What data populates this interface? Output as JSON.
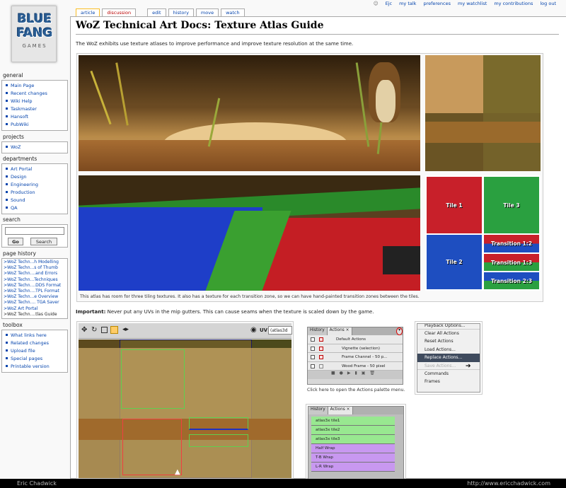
{
  "logo": {
    "line1": "BLUE",
    "line2": "FANG",
    "line3": "GAMES"
  },
  "personal": [
    "Ejc",
    "my talk",
    "preferences",
    "my watchlist",
    "my contributions",
    "log out"
  ],
  "tabs": {
    "article": "article",
    "discussion": "discussion",
    "edit": "edit",
    "history": "history",
    "move": "move",
    "watch": "watch"
  },
  "sidebar": {
    "general": {
      "title": "general",
      "items": [
        "Main Page",
        "Recent changes",
        "Wiki Help",
        "Taskmaster",
        "Hansoft",
        "PubWiki"
      ]
    },
    "projects": {
      "title": "projects",
      "items": [
        "WoZ"
      ]
    },
    "departments": {
      "title": "departments",
      "items": [
        "Art Portal",
        "Design",
        "Engineering",
        "Production",
        "Sound",
        "QA"
      ]
    },
    "search": {
      "title": "search",
      "go": "Go",
      "search": "Search"
    },
    "page_history": {
      "title": "page history",
      "items": [
        ">WoZ Techn...h Modelling",
        ">WoZ Techn...s of Thumb",
        ">WoZ Techn....and Errors",
        ">WoZ Techn...Techniques",
        ">WoZ Techn....DDS Format",
        ">WoZ Techn....TPL Format",
        ">WoZ Techn...e Overview",
        ">WoZ Techn.... TGA Saver",
        ">WoZ Art Portal",
        ">WoZ Techn....tlas Guide"
      ]
    },
    "toolbox": {
      "title": "toolbox",
      "items": [
        "What links here",
        "Related changes",
        "Upload file",
        "Special pages",
        "Printable version"
      ]
    }
  },
  "page": {
    "title": "WoZ Technical Art Docs: Texture Atlas Guide",
    "intro": "The WoZ exhibits use texture atlases to improve performance and improve texture resolution at the same time.",
    "caption": "This atlas has room for three tiling textures. It also has a texture for each transition zone, so we can have hand-painted transition zones between the tiles.",
    "important_label": "Important:",
    "important_text": " Never put any UVs in the mip gutters. This can cause seams when the texture is scaled down by the game.",
    "actions_caption": "Click here to open the Actions palette menu."
  },
  "tiles": {
    "t1": "Tile 1",
    "t2": "Tile 2",
    "t3": "Tile 3",
    "tr12": "Transition 1:2",
    "tr13": "Transition 1:3",
    "tr23": "Transition 2:3"
  },
  "uv_editor": {
    "uv_label": "UV",
    "dropdown": "(atlas3d"
  },
  "actions_panel": {
    "tabs": [
      "History",
      "Actions"
    ],
    "rows": [
      "Default Actions",
      "Vignette (selection)",
      "Frame Channel - 50 p...",
      "Wood Frame - 50 pixel"
    ]
  },
  "actions_menu": {
    "items": [
      "Playback Options...",
      "Clear All Actions",
      "Reset Actions",
      "Load Actions...",
      "Replace Actions...",
      "Save Actions...",
      "Commands",
      "Frames"
    ]
  },
  "actions_panel2": {
    "tabs": [
      "History",
      "Actions"
    ],
    "rows": [
      {
        "label": "atlas3x tile1",
        "color": "#98e890"
      },
      {
        "label": "atlas3x tile2",
        "color": "#98e890"
      },
      {
        "label": "atlas3x tile3",
        "color": "#98e890"
      },
      {
        "label": "Half Wrap",
        "color": "#c898f0"
      },
      {
        "label": "T-B Wrap",
        "color": "#c898f0"
      },
      {
        "label": "L-R Wrap",
        "color": "#c898f0"
      }
    ]
  },
  "footer": {
    "left": "Eric Chadwick",
    "right": "http://www.ericchadwick.com"
  }
}
